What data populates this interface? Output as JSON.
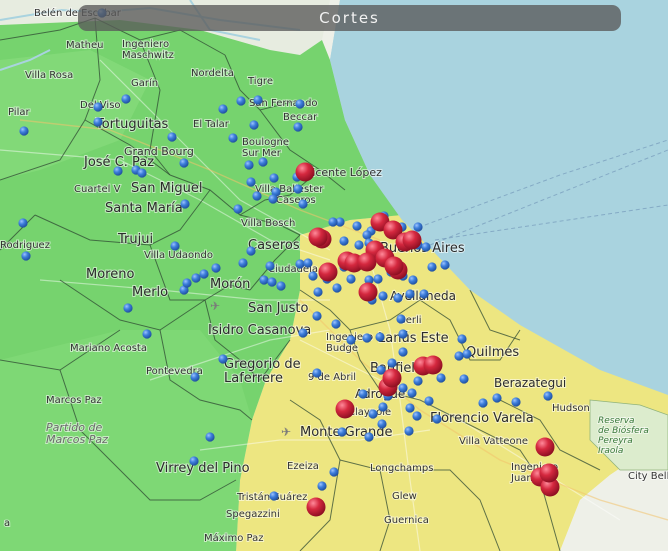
{
  "title": "Cortes",
  "legend_colors": {
    "water": "#a9d3df",
    "zone_green": "#76d36e",
    "zone_green_light": "#8ede7e",
    "zone_yellow": "#ede681",
    "zone_yellow_light": "#f3ee98",
    "unshaded_land": "#eef0e8",
    "blue_marker": "#2f6fd0",
    "red_marker": "#c8203a"
  },
  "places": [
    {
      "id": "belen-de-escobar",
      "label": "Belén de Escobar"
    },
    {
      "id": "matheu",
      "label": "Matheu"
    },
    {
      "id": "ingeniero-maschwitz",
      "label": "Ingeniero\nMaschwitz"
    },
    {
      "id": "villa-rosa",
      "label": "Villa Rosa"
    },
    {
      "id": "garin",
      "label": "Garín"
    },
    {
      "id": "nordelta",
      "label": "Nordelta"
    },
    {
      "id": "tigre",
      "label": "Tigre"
    },
    {
      "id": "del-viso",
      "label": "Del Viso"
    },
    {
      "id": "pilar",
      "label": "Pilar"
    },
    {
      "id": "tortuguitas",
      "label": "Tortuguitas"
    },
    {
      "id": "grand-bourg",
      "label": "Grand Bourg"
    },
    {
      "id": "el-talar",
      "label": "El Talar"
    },
    {
      "id": "san-fernando",
      "label": "San Fernando"
    },
    {
      "id": "beccar",
      "label": "Beccar"
    },
    {
      "id": "boulogne-sur-mer",
      "label": "Boulogne\nSur Mer"
    },
    {
      "id": "jose-c-paz",
      "label": "José C. Paz"
    },
    {
      "id": "cuartel-v",
      "label": "Cuartel V"
    },
    {
      "id": "san-miguel",
      "label": "San Miguel"
    },
    {
      "id": "santa-maria",
      "label": "Santa María"
    },
    {
      "id": "vicente-lopez",
      "label": "Vicente López"
    },
    {
      "id": "villa-ballester",
      "label": "Villa Ballester"
    },
    {
      "id": "caseros-n",
      "label": "Caseros"
    },
    {
      "id": "villa-bosch",
      "label": "Villa Bosch"
    },
    {
      "id": "trujui",
      "label": "Trujui"
    },
    {
      "id": "rodriguez",
      "label": "Rodriguez"
    },
    {
      "id": "caseros",
      "label": "Caseros"
    },
    {
      "id": "buenos-aires",
      "label": "Buenos Aires"
    },
    {
      "id": "villa-udaondo",
      "label": "Villa Udaondo"
    },
    {
      "id": "ciudadela",
      "label": "Ciudadela"
    },
    {
      "id": "moreno",
      "label": "Moreno"
    },
    {
      "id": "moron",
      "label": "Morón"
    },
    {
      "id": "merlo",
      "label": "Merlo"
    },
    {
      "id": "avellaneda",
      "label": "Avellaneda"
    },
    {
      "id": "san-justo",
      "label": "San Justo"
    },
    {
      "id": "gerli",
      "label": "Gerli"
    },
    {
      "id": "isidro-casanova",
      "label": "Isidro Casanova"
    },
    {
      "id": "lanus-este",
      "label": "Lanús Este"
    },
    {
      "id": "ingeniero-budge",
      "label": "Ingeniero\nBudge"
    },
    {
      "id": "mariano-acosta",
      "label": "Mariano Acosta"
    },
    {
      "id": "quilmes",
      "label": "Quilmes"
    },
    {
      "id": "gregorio-de-laferrere",
      "label": "Gregorio de\nLaferrere"
    },
    {
      "id": "banfield",
      "label": "Banfield"
    },
    {
      "id": "pontevedra",
      "label": "Pontevedra"
    },
    {
      "id": "9-de-abril",
      "label": "9 de Abril"
    },
    {
      "id": "berazategui",
      "label": "Berazategui"
    },
    {
      "id": "marcos-paz",
      "label": "Marcos Paz"
    },
    {
      "id": "hudson",
      "label": "Hudson"
    },
    {
      "id": "adrogue",
      "label": "Adrogué"
    },
    {
      "id": "partido-de-marcos-paz",
      "label": "Partido de\nMarcos Paz"
    },
    {
      "id": "claypole",
      "label": "Claypole"
    },
    {
      "id": "florencio-varela",
      "label": "Florencio Varela"
    },
    {
      "id": "reserva",
      "label": "Reserva\nde Biósfera\nPereyra\nIraola"
    },
    {
      "id": "monte-grande",
      "label": "Monte Grande"
    },
    {
      "id": "villa-vatteone",
      "label": "Villa Vatteone"
    },
    {
      "id": "virrey-del-pino",
      "label": "Virrey del Pino"
    },
    {
      "id": "ezeiza",
      "label": "Ezeiza"
    },
    {
      "id": "longchamps",
      "label": "Longchamps"
    },
    {
      "id": "ingeniero-juan",
      "label": "Ingeniero\nJuan"
    },
    {
      "id": "city-bell",
      "label": "City Bell"
    },
    {
      "id": "tristan-suarez",
      "label": "Tristán Suárez"
    },
    {
      "id": "glew",
      "label": "Glew"
    },
    {
      "id": "spegazzini",
      "label": "Spegazzini"
    },
    {
      "id": "guernica",
      "label": "Guernica"
    },
    {
      "id": "maximo-paz",
      "label": "Máximo Paz"
    },
    {
      "id": "cortina",
      "label": "a"
    }
  ]
}
